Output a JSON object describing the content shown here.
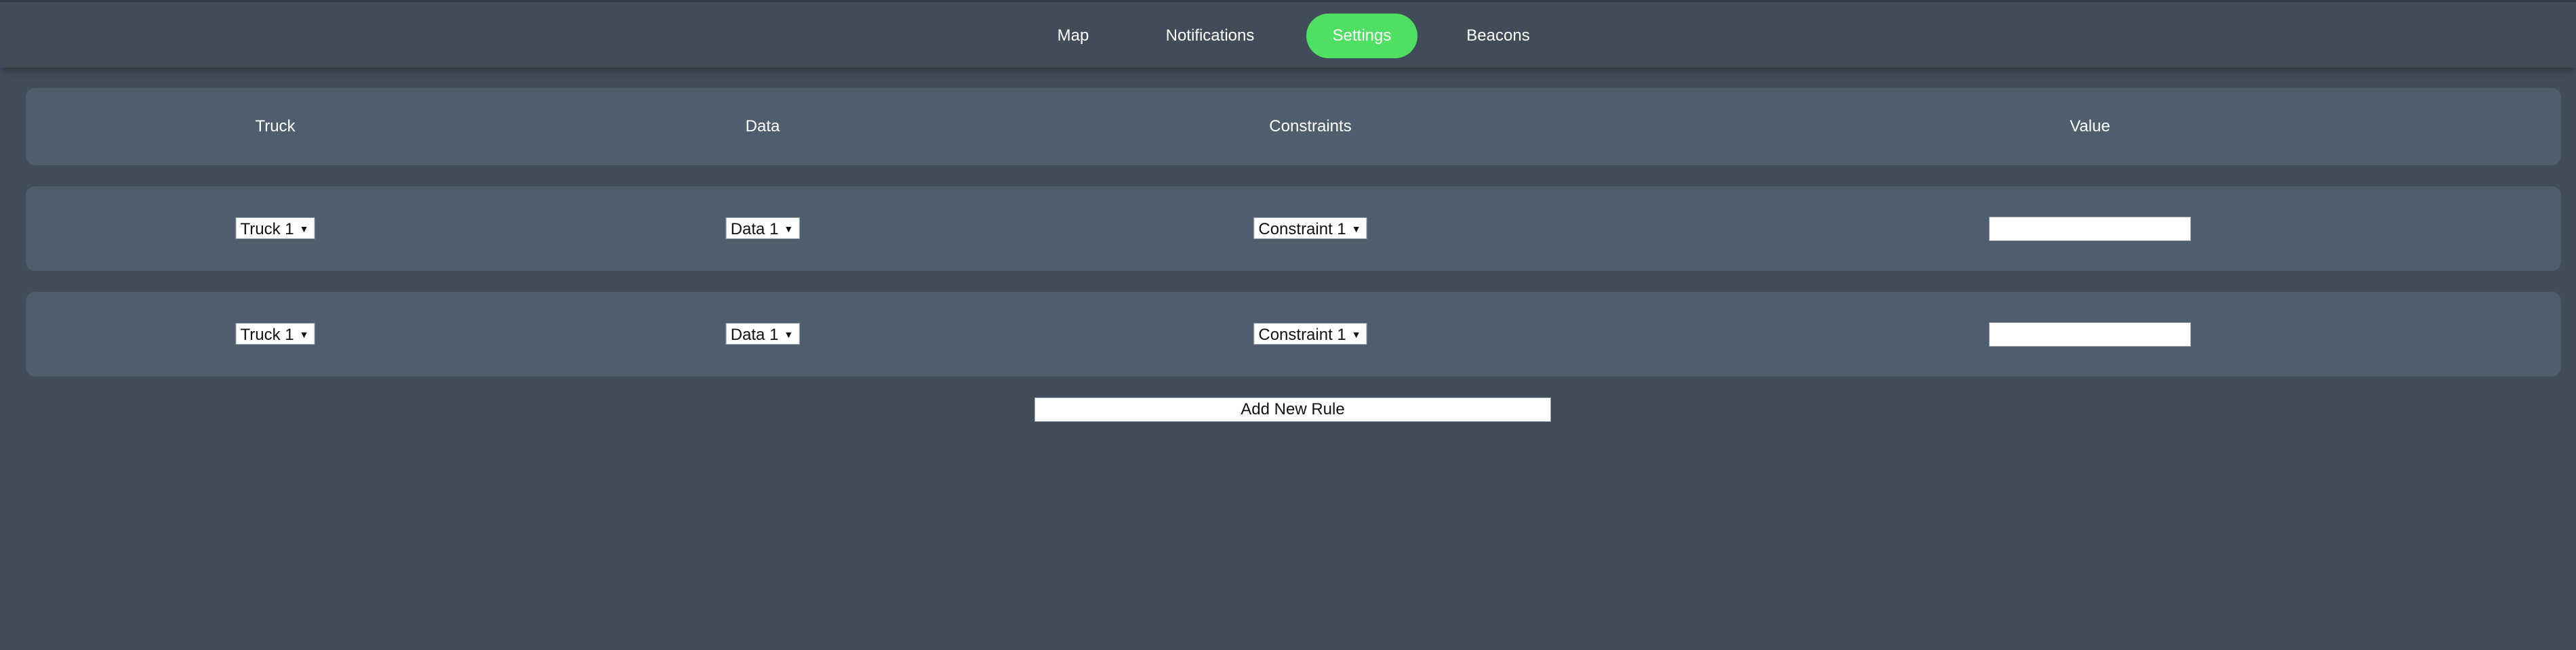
{
  "nav": {
    "items": [
      {
        "label": "Map",
        "active": false
      },
      {
        "label": "Notifications",
        "active": false
      },
      {
        "label": "Settings",
        "active": true
      },
      {
        "label": "Beacons",
        "active": false
      }
    ],
    "active_color": "#4fe063"
  },
  "table": {
    "headers": [
      "Truck",
      "Data",
      "Constraints",
      "Value"
    ],
    "rows": [
      {
        "truck": "Truck 1",
        "data": "Data 1",
        "constraint": "Constraint 1",
        "value": ""
      },
      {
        "truck": "Truck 1",
        "data": "Data 1",
        "constraint": "Constraint 1",
        "value": ""
      }
    ]
  },
  "add_button_label": "Add New Rule",
  "icons": {
    "dropdown": "caret-down-icon"
  },
  "colors": {
    "background": "#414e5a",
    "panel": "#4e5e6c"
  }
}
